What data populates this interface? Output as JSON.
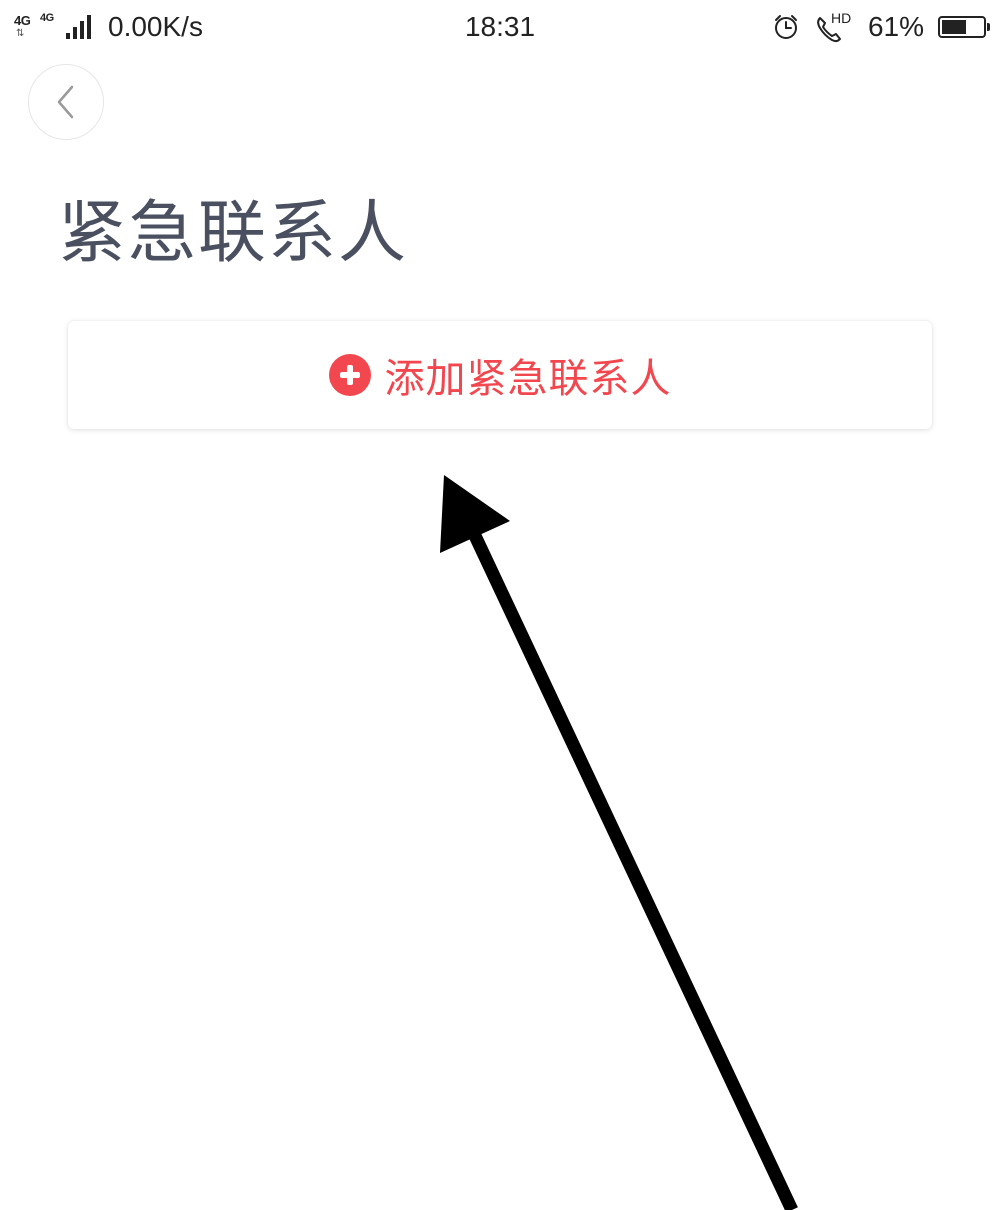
{
  "status_bar": {
    "network_type_1": "4G",
    "network_type_2": "4G",
    "network_arrows": "⇅",
    "data_speed": "0.00K/s",
    "time": "18:31",
    "hd_label": "HD",
    "battery_percent": "61%",
    "battery_level": 0.61,
    "icons": [
      "alarm-icon",
      "hd-call-icon",
      "battery-icon",
      "signal-icon"
    ]
  },
  "header": {
    "back_icon": "chevron-left-icon"
  },
  "page": {
    "title": "紧急联系人"
  },
  "add_contact": {
    "icon": "plus-circle-icon",
    "label": "添加紧急联系人",
    "accent_color": "#f2474f"
  },
  "colors": {
    "title": "#4a5060",
    "accent": "#f2474f",
    "background": "#ffffff"
  }
}
